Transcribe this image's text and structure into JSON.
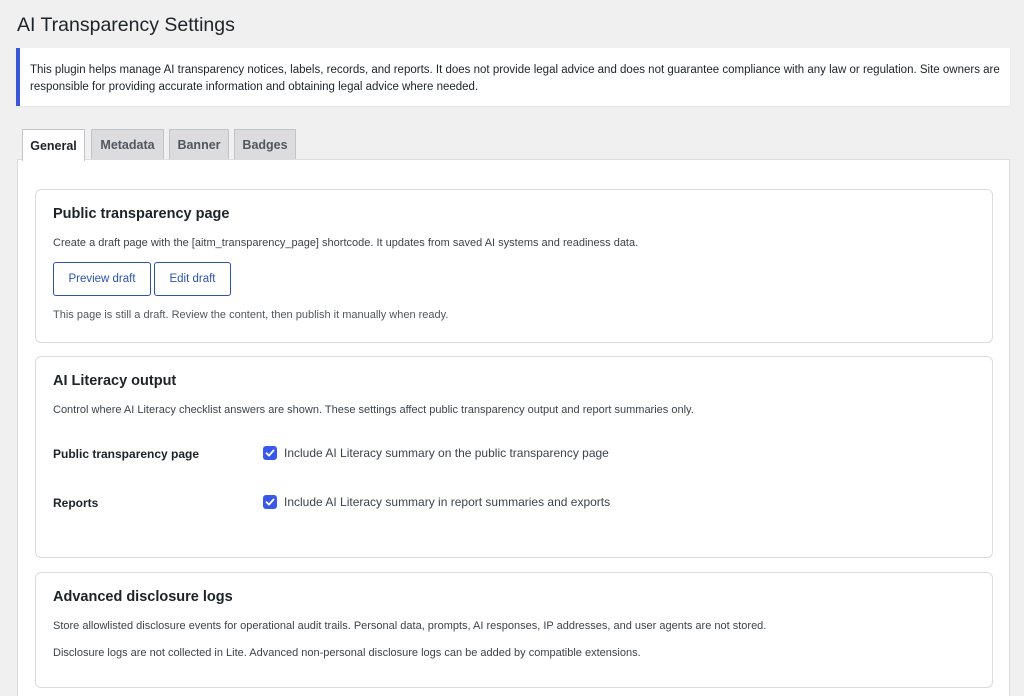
{
  "page": {
    "title": "AI Transparency Settings",
    "notice": "This plugin helps manage AI transparency notices, labels, records, and reports. It does not provide legal advice and does not guarantee compliance with any law or regulation. Site owners are responsible for providing accurate information and obtaining legal advice where needed."
  },
  "tabs": [
    {
      "label": "General",
      "active": true
    },
    {
      "label": "Metadata",
      "active": false
    },
    {
      "label": "Banner",
      "active": false
    },
    {
      "label": "Badges",
      "active": false
    }
  ],
  "transparency_page": {
    "title": "Public transparency page",
    "description": "Create a draft page with the [aitm_transparency_page] shortcode. It updates from saved AI systems and readiness data.",
    "preview_label": "Preview draft",
    "edit_label": "Edit draft",
    "status": "This page is still a draft. Review the content, then publish it manually when ready."
  },
  "literacy": {
    "title": "AI Literacy output",
    "description": "Control where AI Literacy checklist answers are shown. These settings affect public transparency output and report summaries only.",
    "rows": [
      {
        "label": "Public transparency page",
        "checkbox_label": "Include AI Literacy summary on the public transparency page",
        "checked": true
      },
      {
        "label": "Reports",
        "checkbox_label": "Include AI Literacy summary in report summaries and exports",
        "checked": true
      }
    ]
  },
  "logs": {
    "title": "Advanced disclosure logs",
    "text1": "Store allowlisted disclosure events for operational audit trails. Personal data, prompts, AI responses, IP addresses, and user agents are not stored.",
    "text2": "Disclosure logs are not collected in Lite. Advanced non-personal disclosure logs can be added by compatible extensions."
  },
  "colors": {
    "accent": "#3858e9",
    "button_text": "#2c52b0",
    "notice_border": "#3a58d6"
  },
  "icons": {
    "checkbox": "checkmark-icon"
  }
}
